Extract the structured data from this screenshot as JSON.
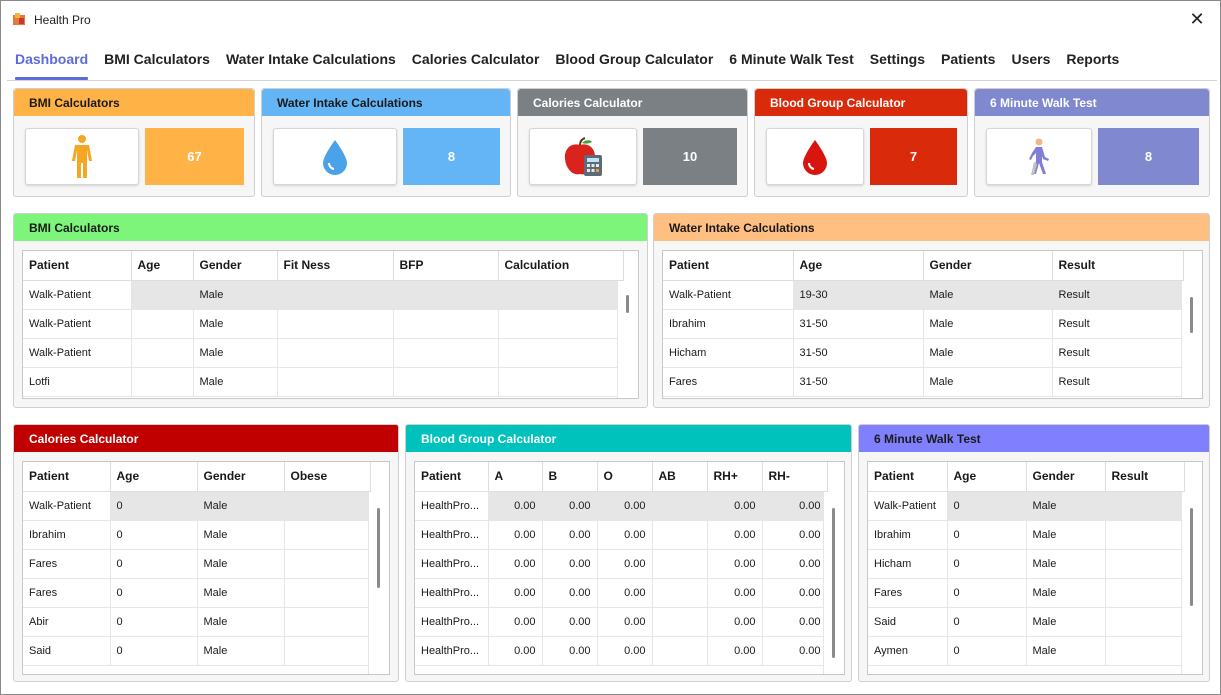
{
  "window": {
    "title": "Health Pro",
    "close_glyph": "✕"
  },
  "nav": [
    "Dashboard",
    "BMI Calculators",
    "Water Intake Calculations",
    "Calories Calculator",
    "Blood Group Calculator",
    "6 Minute Walk Test",
    "Settings",
    "Patients",
    "Users",
    "Reports"
  ],
  "cards": [
    {
      "title": "BMI Calculators",
      "count": "67",
      "icon": "body-figure-icon",
      "color": "#ffb347"
    },
    {
      "title": "Water Intake Calculations",
      "count": "8",
      "icon": "water-drop-icon",
      "color": "#64b5f6"
    },
    {
      "title": "Calories Calculator",
      "count": "10",
      "icon": "apple-calculator-icon",
      "color": "#7b8085"
    },
    {
      "title": "Blood Group Calculator",
      "count": "7",
      "icon": "blood-drop-icon",
      "color": "#d92b0b"
    },
    {
      "title": "6 Minute Walk Test",
      "count": "8",
      "icon": "walking-person-icon",
      "color": "#8088cf"
    }
  ],
  "bmi": {
    "title": "BMI Calculators",
    "color": "#7df57a",
    "columns": [
      "Patient",
      "Age",
      "Gender",
      "Fit Ness",
      "BFP",
      "Calculation"
    ],
    "rows": [
      [
        "Walk-Patient",
        "",
        "Male",
        "",
        "",
        ""
      ],
      [
        "Walk-Patient",
        "",
        "Male",
        "",
        "",
        ""
      ],
      [
        "Walk-Patient",
        "",
        "Male",
        "",
        "",
        ""
      ],
      [
        "Lotfi",
        "",
        "Male",
        "",
        "",
        ""
      ]
    ]
  },
  "water": {
    "title": "Water Intake Calculations",
    "color": "#ffbf80",
    "columns": [
      "Patient",
      "Age",
      "Gender",
      "Result"
    ],
    "rows": [
      [
        "Walk-Patient",
        "19-30",
        "Male",
        "Result"
      ],
      [
        "Ibrahim",
        "31-50",
        "Male",
        "Result"
      ],
      [
        "Hicham",
        "31-50",
        "Male",
        "Result"
      ],
      [
        "Fares",
        "31-50",
        "Male",
        "Result"
      ]
    ]
  },
  "calories": {
    "title": "Calories Calculator",
    "color": "#c00000",
    "columns": [
      "Patient",
      "Age",
      "Gender",
      "Obese"
    ],
    "rows": [
      [
        "Walk-Patient",
        "0",
        "Male",
        ""
      ],
      [
        "Ibrahim",
        "0",
        "Male",
        ""
      ],
      [
        "Fares",
        "0",
        "Male",
        ""
      ],
      [
        "Fares",
        "0",
        "Male",
        ""
      ],
      [
        "Abir",
        "0",
        "Male",
        ""
      ],
      [
        "Said",
        "0",
        "Male",
        ""
      ]
    ]
  },
  "blood": {
    "title": "Blood Group Calculator",
    "color": "#00c2bd",
    "columns": [
      "Patient",
      "A",
      "B",
      "O",
      "AB",
      "RH+",
      "RH-"
    ],
    "rows": [
      [
        "HealthPro...",
        "0.00",
        "0.00",
        "0.00",
        "",
        "0.00",
        "0.00"
      ],
      [
        "HealthPro...",
        "0.00",
        "0.00",
        "0.00",
        "",
        "0.00",
        "0.00"
      ],
      [
        "HealthPro...",
        "0.00",
        "0.00",
        "0.00",
        "",
        "0.00",
        "0.00"
      ],
      [
        "HealthPro...",
        "0.00",
        "0.00",
        "0.00",
        "",
        "0.00",
        "0.00"
      ],
      [
        "HealthPro...",
        "0.00",
        "0.00",
        "0.00",
        "",
        "0.00",
        "0.00"
      ],
      [
        "HealthPro...",
        "0.00",
        "0.00",
        "0.00",
        "",
        "0.00",
        "0.00"
      ]
    ]
  },
  "walk": {
    "title": "6 Minute Walk Test",
    "color": "#8080ff",
    "columns": [
      "Patient",
      "Age",
      "Gender",
      "Result"
    ],
    "rows": [
      [
        "Walk-Patient",
        "0",
        "Male",
        ""
      ],
      [
        "Ibrahim",
        "0",
        "Male",
        ""
      ],
      [
        "Hicham",
        "0",
        "Male",
        ""
      ],
      [
        "Fares",
        "0",
        "Male",
        ""
      ],
      [
        "Said",
        "0",
        "Male",
        ""
      ],
      [
        "Aymen",
        "0",
        "Male",
        ""
      ]
    ]
  }
}
